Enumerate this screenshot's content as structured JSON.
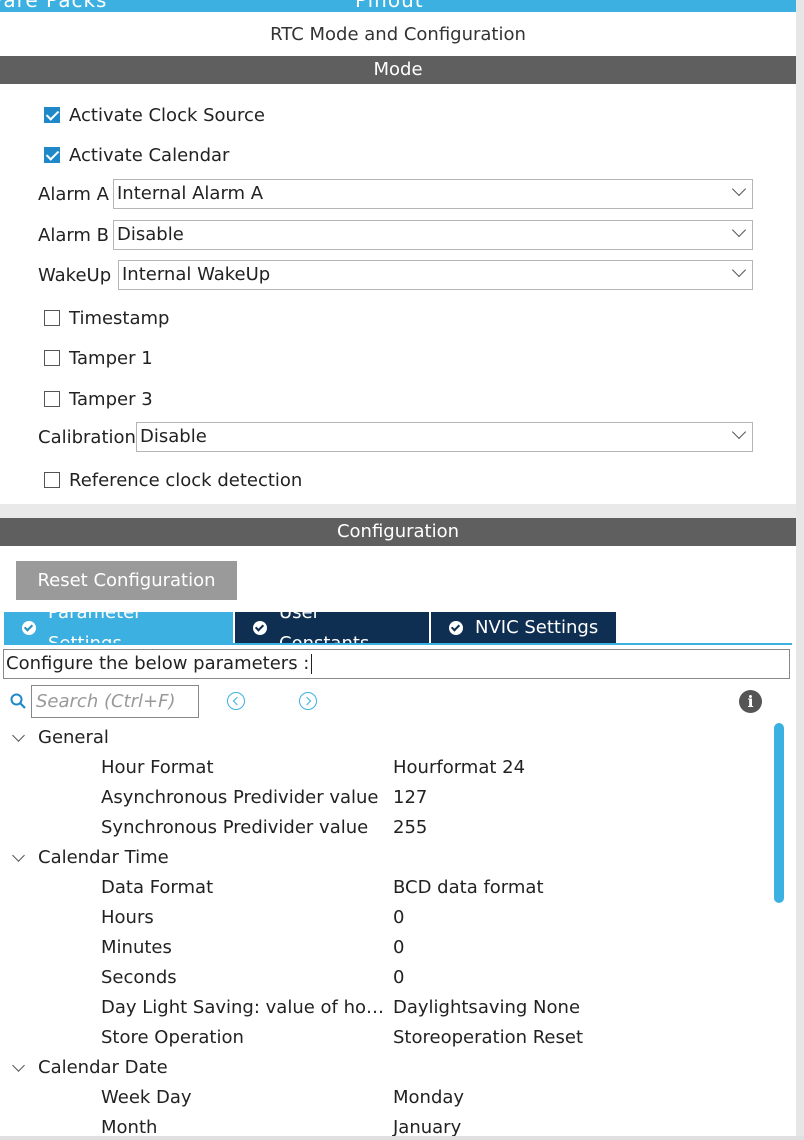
{
  "top_strip": {
    "left_text": "ware Packs",
    "right_text": "Pinout"
  },
  "panel_title": "RTC Mode and Configuration",
  "mode": {
    "header": "Mode",
    "activate_clock_source": {
      "label": "Activate Clock Source",
      "checked": true
    },
    "activate_calendar": {
      "label": "Activate Calendar",
      "checked": true
    },
    "alarm_a": {
      "label": "Alarm A",
      "value": "Internal Alarm A"
    },
    "alarm_b": {
      "label": "Alarm B",
      "value": "Disable"
    },
    "wakeup": {
      "label": "WakeUp",
      "value": "Internal WakeUp"
    },
    "timestamp": {
      "label": "Timestamp",
      "checked": false
    },
    "tamper1": {
      "label": "Tamper 1",
      "checked": false
    },
    "tamper3": {
      "label": "Tamper 3",
      "checked": false
    },
    "calibration": {
      "label": "Calibration",
      "value": "Disable"
    },
    "reference_clock": {
      "label": "Reference clock detection",
      "checked": false
    }
  },
  "configuration": {
    "header": "Configuration",
    "reset_label": "Reset Configuration",
    "tabs": [
      {
        "label": "Parameter Settings",
        "active": true
      },
      {
        "label": "User Constants",
        "active": false
      },
      {
        "label": "NVIC Settings",
        "active": false
      }
    ],
    "description": "Configure the below parameters :",
    "search_placeholder": "Search (Ctrl+F)"
  },
  "tree": {
    "general": {
      "name": "General",
      "params": [
        {
          "name": "Hour Format",
          "value": "Hourformat 24"
        },
        {
          "name": "Asynchronous Predivider value",
          "value": "127"
        },
        {
          "name": "Synchronous Predivider value",
          "value": "255"
        }
      ]
    },
    "calendar_time": {
      "name": "Calendar Time",
      "params": [
        {
          "name": "Data Format",
          "value": "BCD data format"
        },
        {
          "name": "Hours",
          "value": "0"
        },
        {
          "name": "Minutes",
          "value": "0"
        },
        {
          "name": "Seconds",
          "value": "0"
        },
        {
          "name": "Day Light Saving: value of hour adjustment",
          "value": "Daylightsaving None"
        },
        {
          "name": "Store Operation",
          "value": "Storeoperation Reset"
        }
      ]
    },
    "calendar_date": {
      "name": "Calendar Date",
      "params": [
        {
          "name": "Week Day",
          "value": "Monday"
        },
        {
          "name": "Month",
          "value": "January"
        }
      ]
    }
  },
  "colors": {
    "accent": "#3cb0e0",
    "section_bar": "#5f5f5f",
    "tab_inactive": "#0f2f52",
    "button_gray": "#9a9a9a"
  }
}
